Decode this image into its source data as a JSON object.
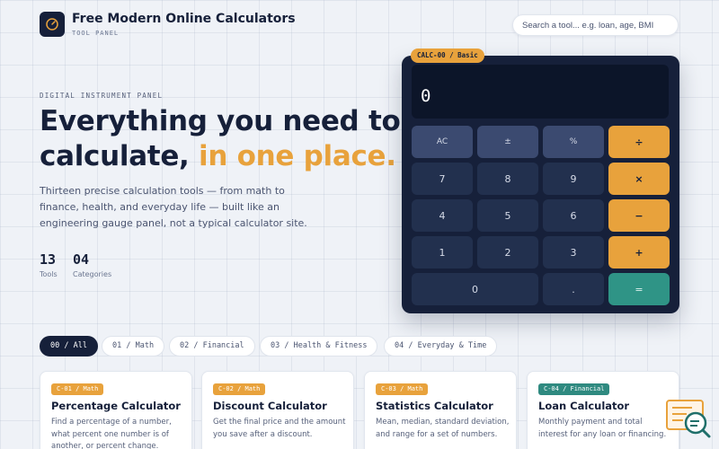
{
  "header": {
    "title": "Free Modern Online Calculators",
    "subtitle": "TOOL PANEL",
    "search_placeholder": "Search a tool... e.g. loan, age, BMI"
  },
  "hero": {
    "eyebrow": "DIGITAL INSTRUMENT PANEL",
    "headline_part1": "Everything you need to",
    "headline_part2": "calculate,",
    "headline_accent": "in one place.",
    "lede": "Thirteen precise calculation tools — from math to finance, health, and everyday life — built like an engineering gauge panel, not a typical calculator site.",
    "stats": [
      {
        "value": "13",
        "label": "Tools"
      },
      {
        "value": "04",
        "label": "Categories"
      }
    ]
  },
  "calculator": {
    "tag": "CALC-00 / Basic",
    "display": "0",
    "keys": {
      "ac": "AC",
      "sign": "±",
      "percent": "%",
      "divide": "÷",
      "k7": "7",
      "k8": "8",
      "k9": "9",
      "multiply": "×",
      "k4": "4",
      "k5": "5",
      "k6": "6",
      "minus": "−",
      "k1": "1",
      "k2": "2",
      "k3": "3",
      "plus": "+",
      "k0": "0",
      "dot": ".",
      "equals": "="
    }
  },
  "filters": [
    {
      "label": "00 / All",
      "active": true
    },
    {
      "label": "01 / Math"
    },
    {
      "label": "02 / Financial"
    },
    {
      "label": "03 / Health & Fitness"
    },
    {
      "label": "04 / Everyday & Time"
    }
  ],
  "cards": [
    {
      "badge": "C-01 / Math",
      "title": "Percentage Calculator",
      "desc": "Find a percentage of a number, what percent one number is of another, or percent change."
    },
    {
      "badge": "C-02 / Math",
      "title": "Discount Calculator",
      "desc": "Get the final price and the amount you save after a discount."
    },
    {
      "badge": "C-03 / Math",
      "title": "Statistics Calculator",
      "desc": "Mean, median, standard deviation, and range for a set of numbers."
    },
    {
      "badge": "C-04 / Financial",
      "title": "Loan Calculator",
      "desc": "Monthly payment and total interest for any loan or financing."
    }
  ],
  "colors": {
    "navy": "#16203a",
    "accent_orange": "#e8a23c",
    "teal": "#2f9486",
    "math_badge": "#e8a23c",
    "financial_badge": "#2f8a80"
  }
}
